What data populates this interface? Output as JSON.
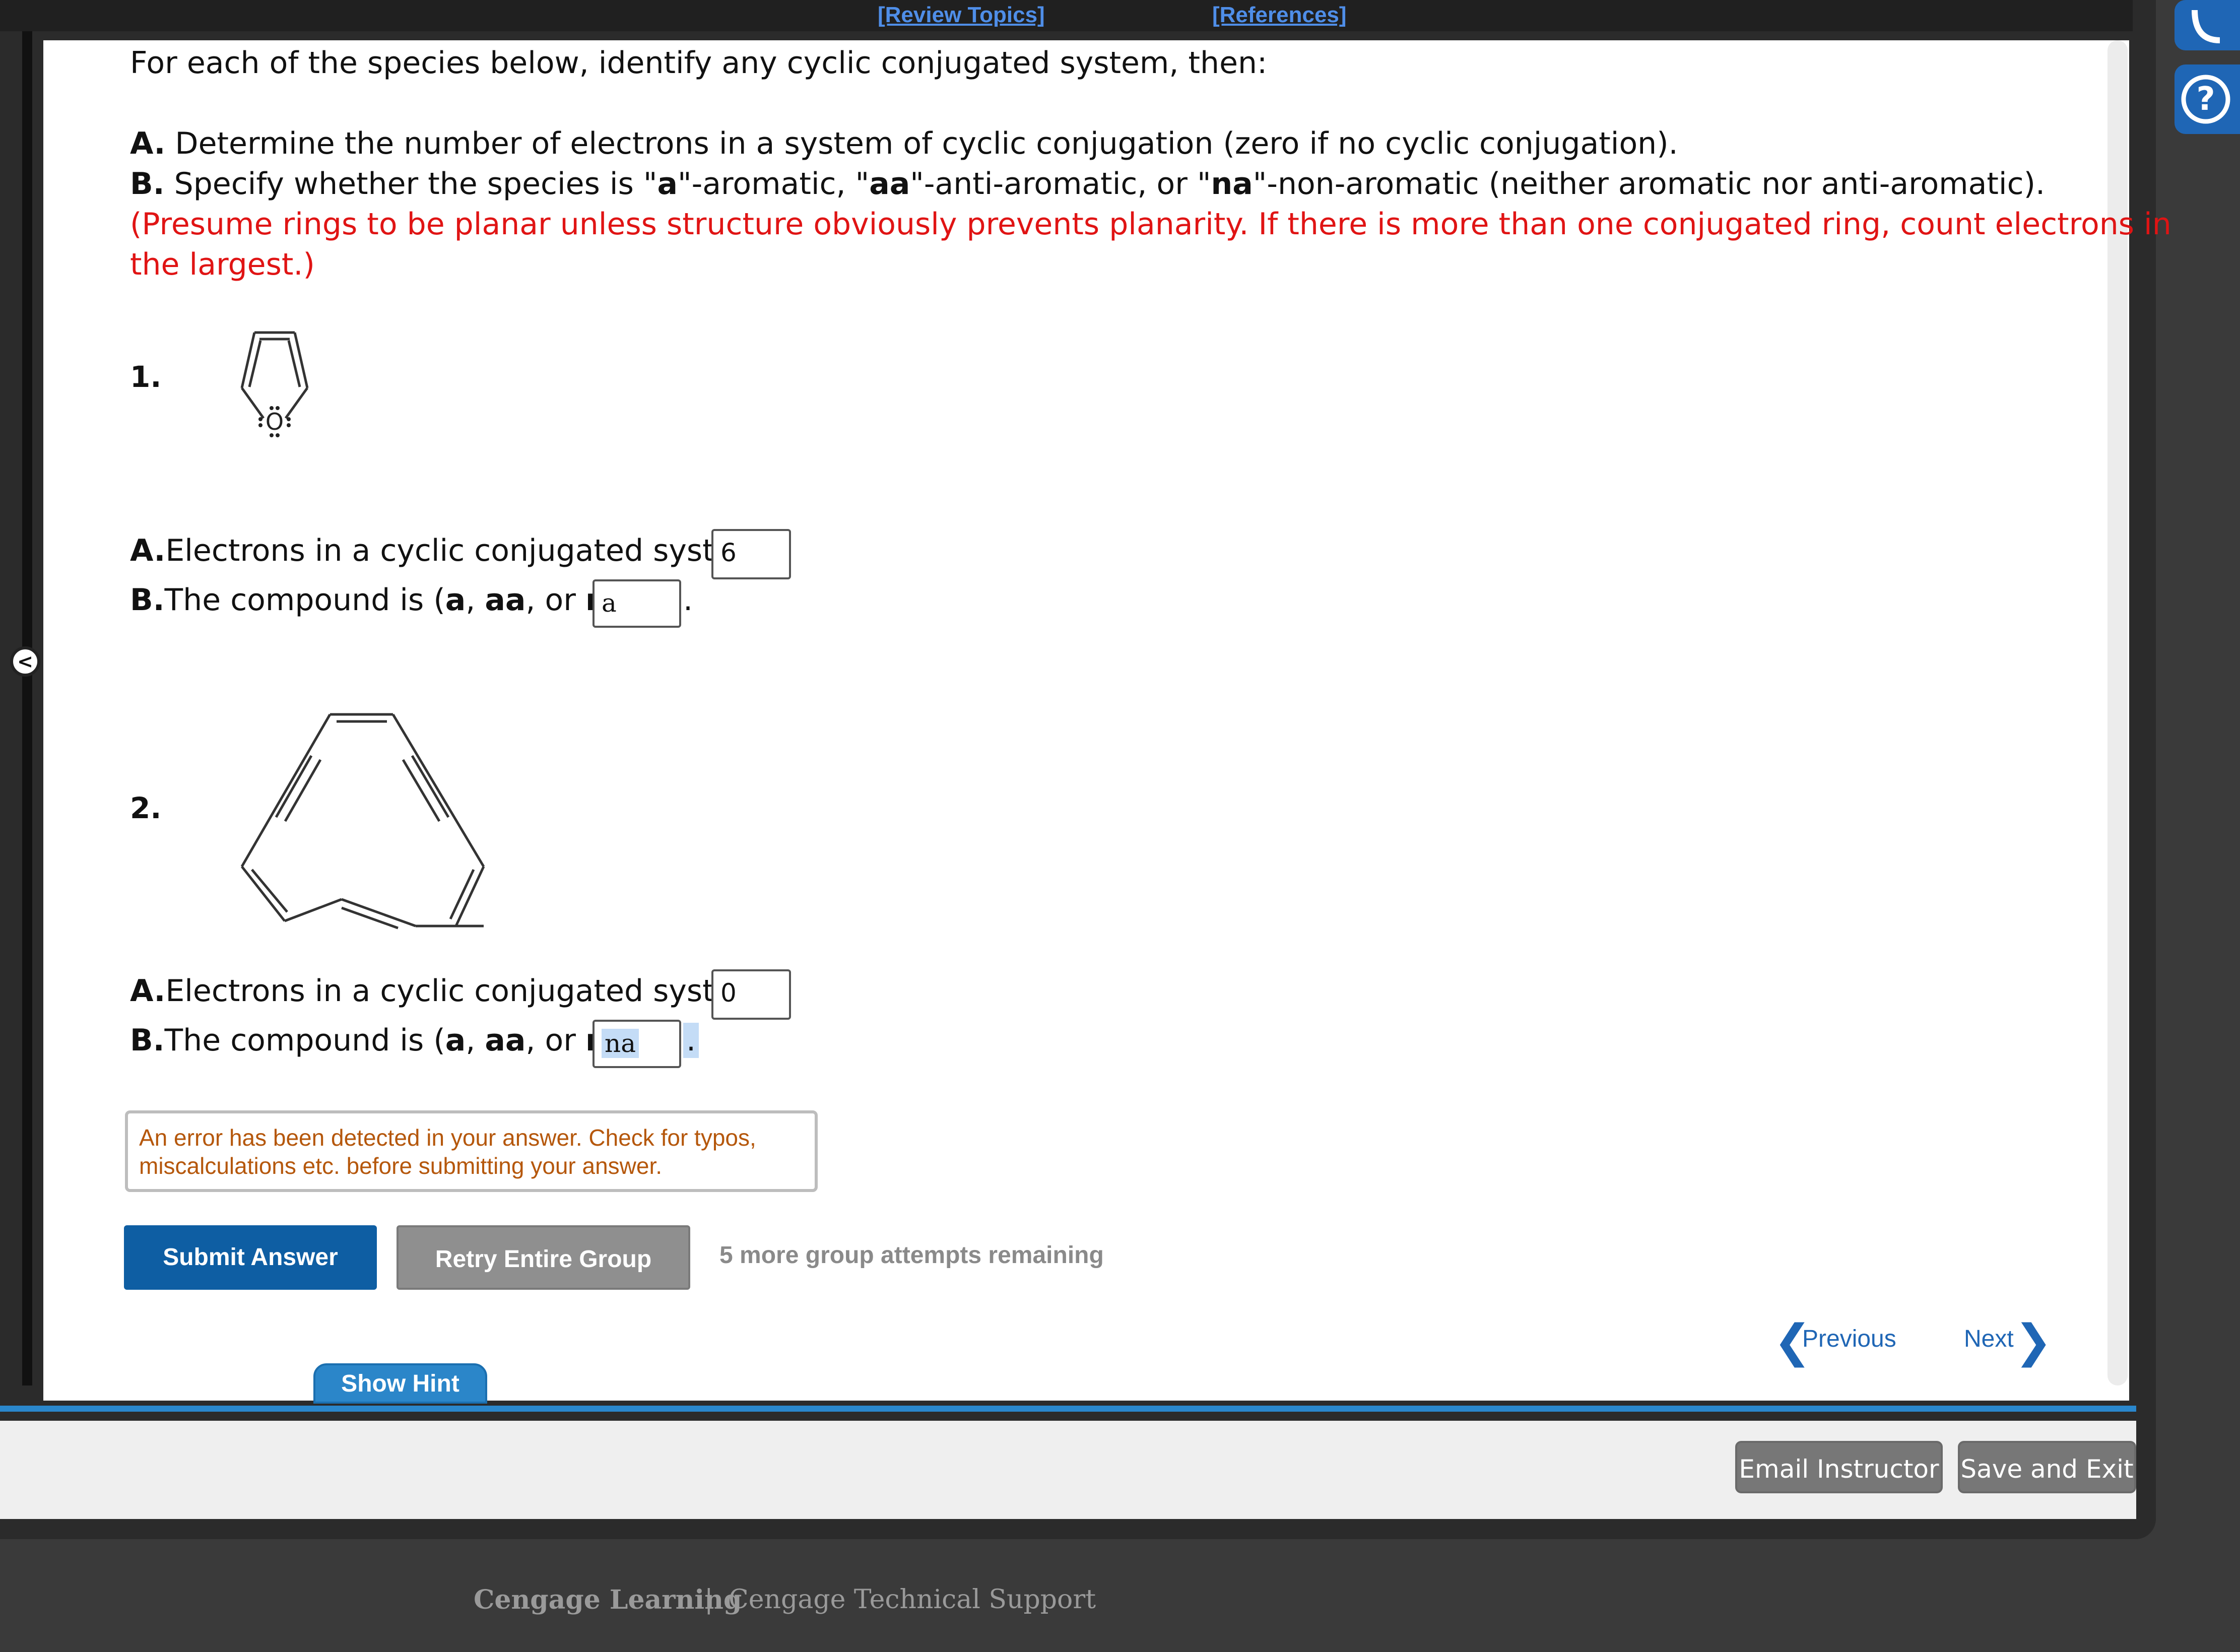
{
  "header": {
    "review_topics": "[Review Topics]",
    "references": "[References]"
  },
  "instructions": {
    "intro": "For each of the species below, identify any cyclic conjugated system, then:",
    "a_label": "A.",
    "a_text": " Determine the number of electrons in a system of cyclic conjugation (zero if no cyclic conjugation).",
    "b_label": "B.",
    "b_text_1": " Specify whether the species is \"",
    "b_a": "a",
    "b_text_2": "\"-aromatic, \"",
    "b_aa": "aa",
    "b_text_3": "\"-anti-aromatic, or \"",
    "b_na": "na",
    "b_text_4": "\"-non-aromatic (neither aromatic nor anti-aromatic).",
    "note_line1": "(Presume rings to be planar unless structure obviously prevents planarity. If there is more than one conjugated ring, count electrons in",
    "note_line2": "the largest.)"
  },
  "questions": [
    {
      "number": "1.",
      "a_label": "A.",
      "a_text": "Electrons in a cyclic conjugated system.",
      "a_value": "6",
      "b_label": "B.",
      "b_text": "The compound is (",
      "b_opt1": "a",
      "b_sep1": ", ",
      "b_opt2": "aa",
      "b_sep2": ", or ",
      "b_opt3": "na",
      "b_close": ")",
      "b_value": "a",
      "period": "."
    },
    {
      "number": "2.",
      "a_label": "A.",
      "a_text": "Electrons in a cyclic conjugated system.",
      "a_value": "0",
      "b_label": "B.",
      "b_text": "The compound is (",
      "b_opt1": "a",
      "b_sep1": ", ",
      "b_opt2": "aa",
      "b_sep2": ", or ",
      "b_opt3": "na",
      "b_close": ")",
      "b_value": "na",
      "period": "."
    }
  ],
  "molecule1": {
    "atom_label": "O"
  },
  "error_message": "An error has been detected in your answer. Check for typos, miscalculations etc. before submitting your answer.",
  "buttons": {
    "submit": "Submit Answer",
    "retry": "Retry Entire Group",
    "attempts": "5 more group attempts remaining",
    "previous": "Previous",
    "next": "Next",
    "show_hint": "Show Hint",
    "email_instructor": "Email Instructor",
    "save_exit": "Save and Exit"
  },
  "footer": {
    "brand": "Cengage Learning",
    "separator": "|",
    "support": "Cengage Technical Support"
  },
  "icons": {
    "collapse": "<",
    "help": "?"
  },
  "colors": {
    "accent": "#0e5ea3",
    "link": "#1f66b5",
    "note": "#e01414",
    "error_text": "#b5570b"
  }
}
